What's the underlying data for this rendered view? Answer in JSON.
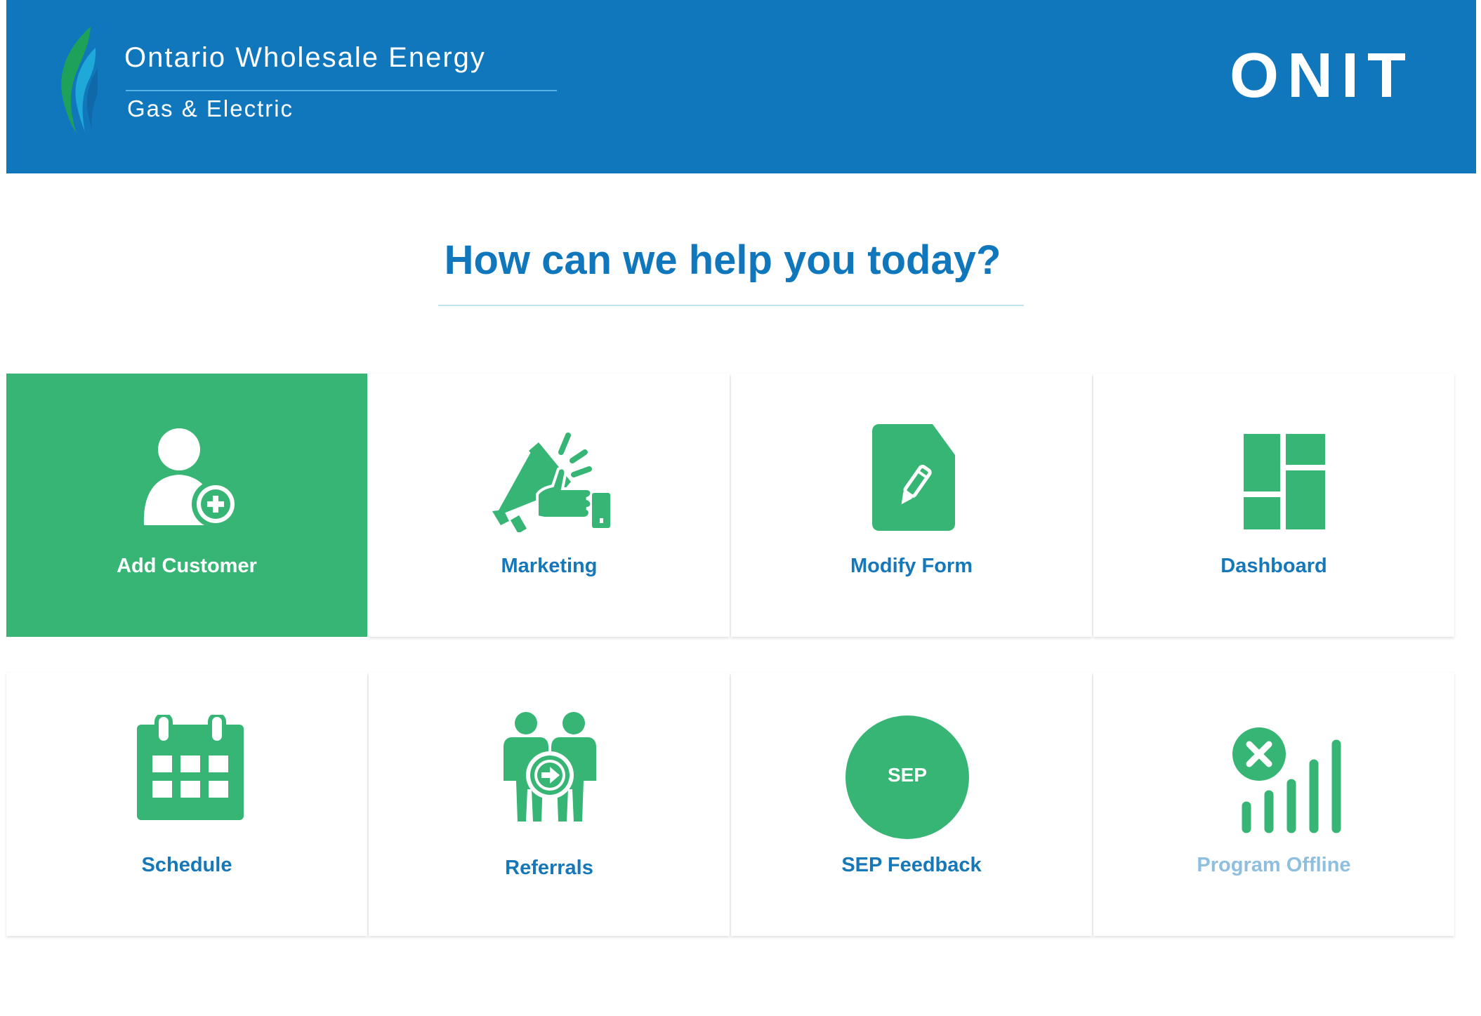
{
  "header": {
    "brand_name": "Ontario Wholesale Energy",
    "brand_sub": "Gas & Electric",
    "app_name": "ONIT"
  },
  "main": {
    "headline": "How can we help you today?",
    "tiles": [
      {
        "label": "Add Customer",
        "icon": "add-user-icon",
        "state": "selected"
      },
      {
        "label": "Marketing",
        "icon": "megaphone-thumbs-up-icon"
      },
      {
        "label": "Modify Form",
        "icon": "edit-document-icon"
      },
      {
        "label": "Dashboard",
        "icon": "dashboard-layout-icon"
      },
      {
        "label": "Schedule",
        "icon": "calendar-icon"
      },
      {
        "label": "Referrals",
        "icon": "referral-people-icon"
      },
      {
        "label": "SEP Feedback",
        "icon": "sep-circle-icon",
        "badge": "SEP"
      },
      {
        "label": "Program Offline",
        "icon": "no-signal-icon",
        "state": "disabled"
      }
    ]
  },
  "colors": {
    "header_bg": "#1077bd",
    "accent_green": "#37b574",
    "label_blue": "#1677b9",
    "disabled_blue": "#8fbfdf"
  }
}
